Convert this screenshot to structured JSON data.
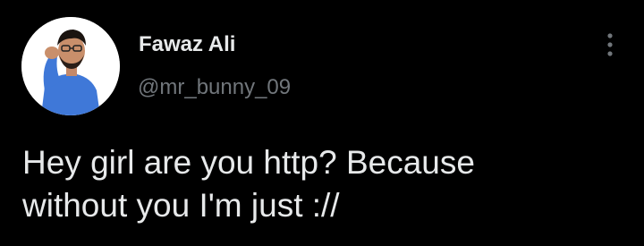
{
  "tweet": {
    "author": {
      "display_name": "Fawaz Ali",
      "handle": "@mr_bunny_09",
      "avatar_icon": "profile-photo"
    },
    "more_icon": "more-vertical-icon",
    "text_lines": [
      "Hey girl are you http? Because",
      "without you I'm just ://"
    ]
  },
  "colors": {
    "background": "#000000",
    "primary_text": "#e7e9ea",
    "secondary_text": "#71767b"
  }
}
